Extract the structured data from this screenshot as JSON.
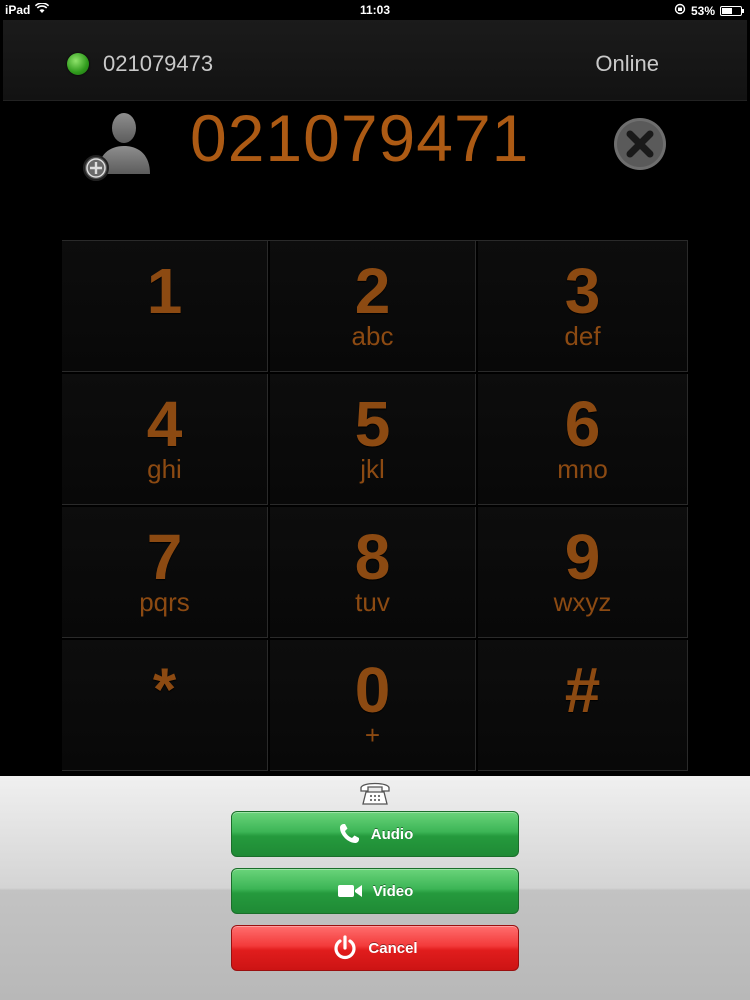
{
  "status_bar": {
    "device": "iPad",
    "time": "11:03",
    "battery_percent": "53%",
    "battery_level": 0.53,
    "icons": [
      "wifi-icon",
      "lock-rotation-icon",
      "battery-icon"
    ]
  },
  "header": {
    "account_number": "021079473",
    "presence": "Online",
    "presence_color": "#3fb52a"
  },
  "dialer": {
    "number": "021079471",
    "icons": [
      "add-contact-icon",
      "clear-icon"
    ],
    "accent_color": "#ac5a14"
  },
  "keypad": {
    "keys": [
      {
        "digit": "1",
        "letters": ""
      },
      {
        "digit": "2",
        "letters": "abc"
      },
      {
        "digit": "3",
        "letters": "def"
      },
      {
        "digit": "4",
        "letters": "ghi"
      },
      {
        "digit": "5",
        "letters": "jkl"
      },
      {
        "digit": "6",
        "letters": "mno"
      },
      {
        "digit": "7",
        "letters": "pqrs"
      },
      {
        "digit": "8",
        "letters": "tuv"
      },
      {
        "digit": "9",
        "letters": "wxyz"
      },
      {
        "digit": "*",
        "letters": ""
      },
      {
        "digit": "0",
        "letters": "+"
      },
      {
        "digit": "#",
        "letters": ""
      }
    ]
  },
  "call_sheet": {
    "icon": "telephone-icon",
    "audio_label": "Audio",
    "video_label": "Video",
    "cancel_label": "Cancel",
    "colors": {
      "green": "#259a3d",
      "red": "#e11d1d"
    }
  }
}
